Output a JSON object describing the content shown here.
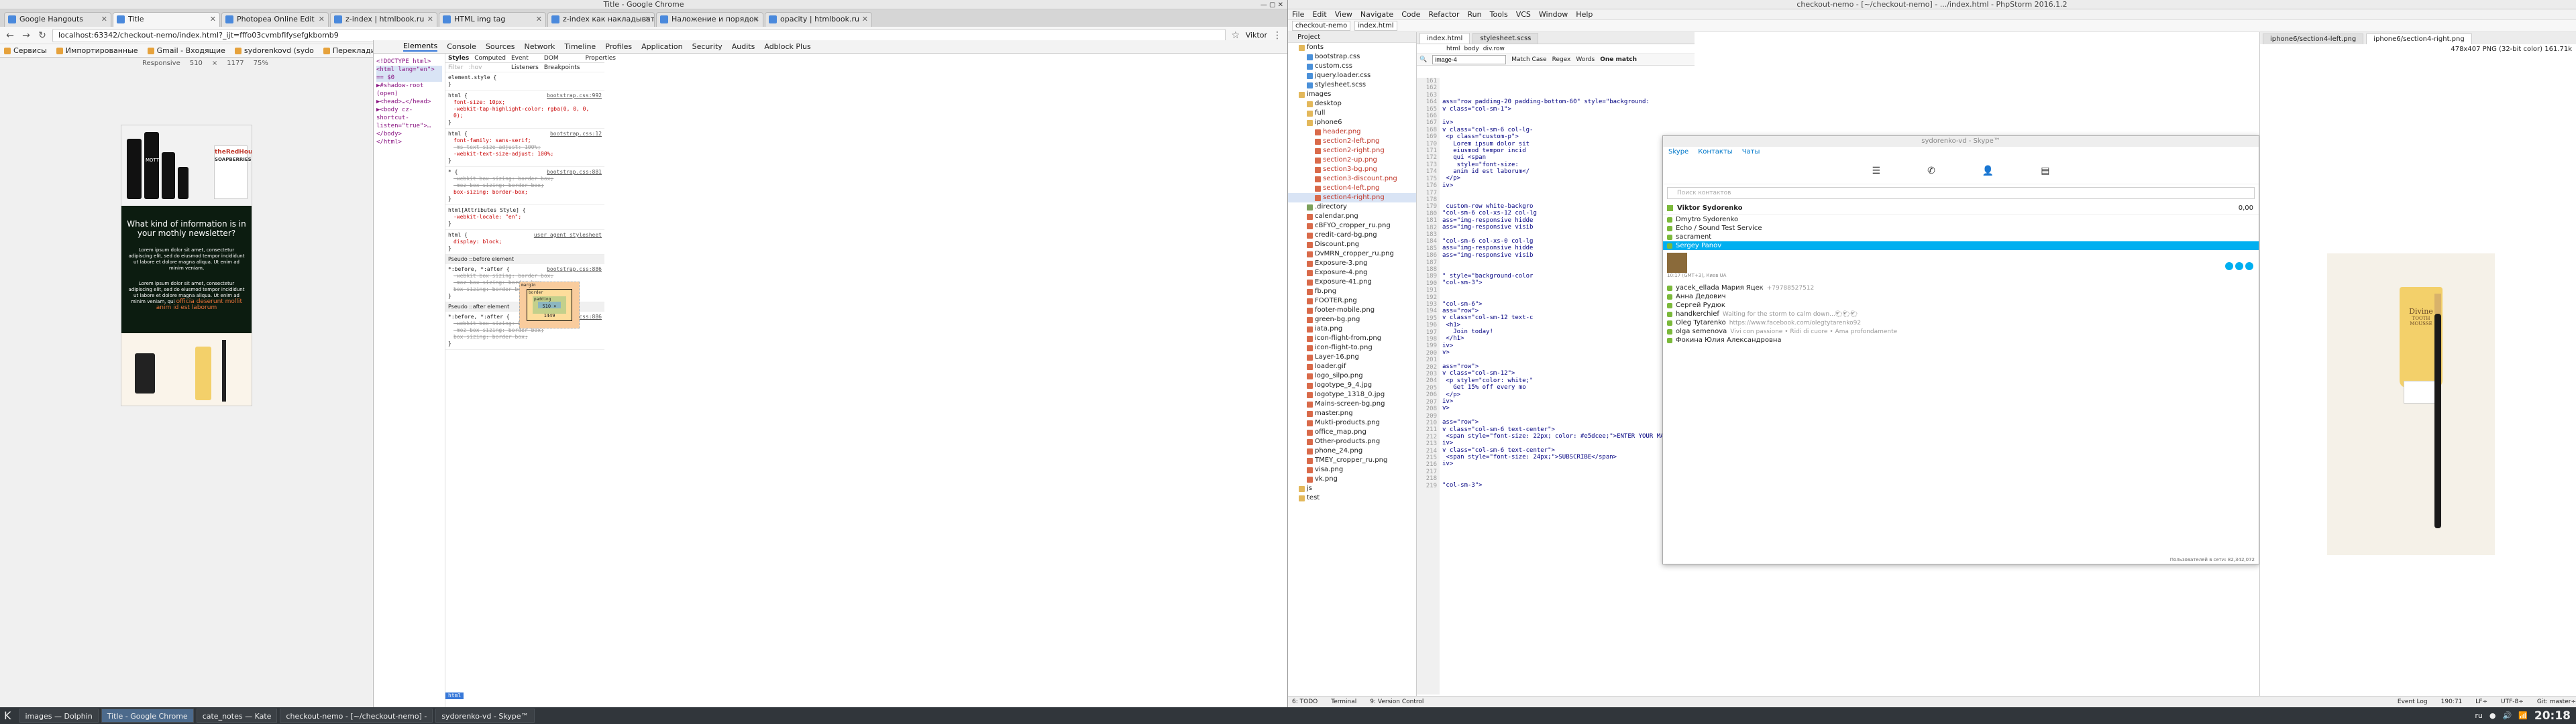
{
  "chrome": {
    "window_title": "Title - Google Chrome",
    "tabs": [
      "Google Hangouts",
      "Title",
      "Photopea Online Edit",
      "z-index | htmlbook.ru",
      "HTML img tag",
      "z-index как накладывать сло",
      "Наложение и порядок",
      "opacity | htmlbook.ru"
    ],
    "active_tab": 1,
    "user": "Viktor",
    "url": "localhost:63342/checkout-nemo/index.html?_ijt=fffo03cvmbfifysefgkbomb9",
    "bookmarks": [
      "Сервисы",
      "Импортированные",
      "Gmail - Входящие",
      "sydorenkovd (sydo",
      "Переклади Goo",
      "W3Schools Online",
      "AngularJS: Develo",
      "delete"
    ],
    "device": {
      "name": "Responsive",
      "width": "510",
      "x": "×",
      "height": "1177",
      "zoom": "75%"
    }
  },
  "page": {
    "newsletter_title": "What kind of information is in your mothly newsletter?",
    "para1": "Lorem ipsum dolor sit amet, consectetur adipiscing elit, sed do eiusmod tempor incididunt ut labore et dolore magna aliqua. Ut enim ad minim veniam,",
    "para2": "Lorem ipsum dolor sit amet, consectetur adipiscing elit, sed do eiusmod tempor incididunt ut labore et dolore magna aliqua. Ut enim ad minim veniam, qui",
    "para2_accent": "officia deserunt mollit anim id est laborum",
    "brand1": "MOTTI",
    "brand2": "theRedHour",
    "brand2_sub": "SOAPBERRIES"
  },
  "devtools": {
    "tabs": [
      "Elements",
      "Console",
      "Sources",
      "Network",
      "Timeline",
      "Profiles",
      "Application",
      "Security",
      "Audits",
      "Adblock Plus"
    ],
    "dom": [
      "<!DOCTYPE html>",
      "<html lang=\"en\"> == $0",
      "▶#shadow-root (open)",
      "▶<head>…</head>",
      "▶<body cz-shortcut-listen=\"true\">…</body>",
      "</html>"
    ],
    "styles_tabs": [
      "Styles",
      "Computed",
      "Event Listeners",
      "DOM Breakpoints",
      "Properties"
    ],
    "filter": "Filter",
    "filter_opts": ":hov",
    "rules": [
      {
        "sel": "element.style {",
        "src": "",
        "props": []
      },
      {
        "sel": "html {",
        "src": "bootstrap.css:992",
        "props": [
          "font-size: 10px;",
          "-webkit-tap-highlight-color: rgba(0, 0, 0, 0);"
        ]
      },
      {
        "sel": "html {",
        "src": "bootstrap.css:12",
        "props": [
          "font-family: sans-serif;",
          "-ms-text-size-adjust: 100%;",
          "-webkit-text-size-adjust: 100%;"
        ]
      },
      {
        "sel": "* {",
        "src": "bootstrap.css:881",
        "props": [
          "-webkit-box-sizing: border-box;",
          "-moz-box-sizing: border-box;",
          "box-sizing: border-box;"
        ]
      },
      {
        "sel": "html[Attributes Style] {",
        "src": "",
        "props": [
          "-webkit-locale: \"en\";"
        ]
      },
      {
        "sel": "html {",
        "src": "user agent stylesheet",
        "props": [
          "display: block;"
        ]
      }
    ],
    "pseudo_before": "Pseudo ::before element",
    "before_rule": {
      "sel": "*:before, *:after {",
      "src": "bootstrap.css:886",
      "props": [
        "-webkit-box-sizing: border-box;",
        "-moz-box-sizing: border-box;",
        "box-sizing: border-box;"
      ]
    },
    "pseudo_after": "Pseudo ::after element",
    "after_rule": {
      "sel": "*:before, *:after {",
      "src": "bootstrap.css:886",
      "props": [
        "-webkit-box-sizing: border-box;",
        "-moz-box-sizing: border-box;",
        "box-sizing: border-box;"
      ]
    },
    "boxmodel": {
      "margin": "margin",
      "border": "border",
      "padding": "padding",
      "content": "510 × 1449"
    },
    "html_tag": "html"
  },
  "ide": {
    "title": "checkout-nemo - [~/checkout-nemo] - .../index.html - PhpStorm 2016.1.2",
    "menu": [
      "File",
      "Edit",
      "View",
      "Navigate",
      "Code",
      "Refactor",
      "Run",
      "Tools",
      "VCS",
      "Window",
      "Help"
    ],
    "breadcrumb": [
      "checkout-nemo",
      "index.html"
    ],
    "project_label": "Project",
    "tree": [
      {
        "name": "fonts",
        "type": "folder"
      },
      {
        "name": "bootstrap.css",
        "type": "css"
      },
      {
        "name": "custom.css",
        "type": "css"
      },
      {
        "name": "jquery.loader.css",
        "type": "css"
      },
      {
        "name": "stylesheet.scss",
        "type": "css"
      },
      {
        "name": "images",
        "type": "folder"
      },
      {
        "name": "desktop",
        "type": "folder"
      },
      {
        "name": "full",
        "type": "folder"
      },
      {
        "name": "iphone6",
        "type": "folder"
      },
      {
        "name": "header.png",
        "type": "img"
      },
      {
        "name": "section2-left.png",
        "type": "img"
      },
      {
        "name": "section2-right.png",
        "type": "img"
      },
      {
        "name": "section2-up.png",
        "type": "img"
      },
      {
        "name": "section3-bg.png",
        "type": "img"
      },
      {
        "name": "section3-discount.png",
        "type": "img"
      },
      {
        "name": "section4-left.png",
        "type": "img"
      },
      {
        "name": "section4-right.png",
        "type": "img"
      },
      {
        "name": ".directory",
        "type": "file"
      },
      {
        "name": "calendar.png",
        "type": "img"
      },
      {
        "name": "cBFYO_cropper_ru.png",
        "type": "img"
      },
      {
        "name": "credit-card-bg.png",
        "type": "img"
      },
      {
        "name": "Discount.png",
        "type": "img"
      },
      {
        "name": "DvMRN_cropper_ru.png",
        "type": "img"
      },
      {
        "name": "Exposure-3.png",
        "type": "img"
      },
      {
        "name": "Exposure-4.png",
        "type": "img"
      },
      {
        "name": "Exposure-41.png",
        "type": "img"
      },
      {
        "name": "fb.png",
        "type": "img"
      },
      {
        "name": "FOOTER.png",
        "type": "img"
      },
      {
        "name": "footer-mobile.png",
        "type": "img"
      },
      {
        "name": "green-bg.png",
        "type": "img"
      },
      {
        "name": "iata.png",
        "type": "img"
      },
      {
        "name": "icon-flight-from.png",
        "type": "img"
      },
      {
        "name": "icon-flight-to.png",
        "type": "img"
      },
      {
        "name": "Layer-16.png",
        "type": "img"
      },
      {
        "name": "loader.gif",
        "type": "img"
      },
      {
        "name": "logo_silpo.png",
        "type": "img"
      },
      {
        "name": "logotype_9_4.jpg",
        "type": "img"
      },
      {
        "name": "logotype_1318_0.jpg",
        "type": "img"
      },
      {
        "name": "Mains-screen-bg.png",
        "type": "img"
      },
      {
        "name": "master.png",
        "type": "img"
      },
      {
        "name": "Mukti-products.png",
        "type": "img"
      },
      {
        "name": "office_map.png",
        "type": "img"
      },
      {
        "name": "Other-products.png",
        "type": "img"
      },
      {
        "name": "phone_24.png",
        "type": "img"
      },
      {
        "name": "TMEY_cropper_ru.png",
        "type": "img"
      },
      {
        "name": "visa.png",
        "type": "img"
      },
      {
        "name": "vk.png",
        "type": "img"
      },
      {
        "name": "js",
        "type": "folder"
      },
      {
        "name": "test",
        "type": "folder"
      }
    ],
    "editor_tabs": [
      "index.html",
      "stylesheet.scss"
    ],
    "code_crumbs": [
      "html",
      "body",
      "div.row"
    ],
    "search_value": "image-4",
    "search_opts": [
      "Match Case",
      "Regex",
      "Words"
    ],
    "search_result": "One match",
    "line_start": 161,
    "code": [
      "",
      "",
      "",
      "ass=\"row padding-20 padding-bottom-60\" style=\"background:",
      "v class=\"col-sm-1\">",
      "",
      "iv>",
      "v class=\"col-sm-6 col-lg-",
      " <p class=\"custom-p\">",
      "   Lorem ipsum dolor sit",
      "   eiusmod tempor incid",
      "   qui <span",
      "    style=\"font-size:",
      "   anim id est laborum</",
      " </p>",
      "iv>",
      "",
      "",
      " custom-row white-backgro",
      "\"col-sm-6 col-xs-12 col-lg",
      "ass=\"img-responsive hidde",
      "ass=\"img-responsive visib",
      "",
      "\"col-sm-6 col-xs-0 col-lg",
      "ass=\"img-responsive hidde",
      "ass=\"img-responsive visib",
      "",
      "",
      "\" style=\"background-color",
      "\"col-sm-3\">",
      "",
      "",
      "\"col-sm-6\">",
      "ass=\"row\">",
      "v class=\"col-sm-12 text-c",
      " <h1>",
      "   Join today!",
      " </h1>",
      "iv>",
      "v>",
      "",
      "ass=\"row\">",
      "v class=\"col-sm-12\">",
      " <p style=\"color: white;\"",
      "   Get 15% off every mo",
      " </p>",
      "iv>",
      "v>",
      "",
      "ass=\"row\">",
      "v class=\"col-sm-6 text-center\">",
      " <span style=\"font-size: 22px; color: #e5dcee;\">ENTER YOUR MAIL</span>",
      "iv>",
      "v class=\"col-sm-6 text-center\">",
      " <span style=\"font-size: 24px;\">SUBSCRIBE</span>",
      "iv>",
      "",
      "",
      "\"col-sm-3\">"
    ]
  },
  "skype": {
    "title": "sydorenko-vd - Skype™",
    "menu": [
      "Skype",
      "Контакты",
      "Чаты"
    ],
    "search_placeholder": "Поиск контактов",
    "user": "Viktor Sydorenko",
    "balance": "0,00",
    "contacts": [
      {
        "name": "Dmytro Sydorenko",
        "mood": ""
      },
      {
        "name": "Echo / Sound Test Service",
        "mood": ""
      },
      {
        "name": "sacrament",
        "mood": ""
      },
      {
        "name": "Sergey Panov",
        "mood": ""
      },
      {
        "name": "yacek_ellada Мария Яцек",
        "mood": "+79788527512"
      },
      {
        "name": "Анна Дедович",
        "mood": ""
      },
      {
        "name": "Сергей Рудюк",
        "mood": ""
      },
      {
        "name": "handkerchief",
        "mood": "Waiting for the storm to calm down...🐑🐑🐑"
      },
      {
        "name": "Oleg Tytarenko",
        "mood": "https://www.facebook.com/olegtytarenko92"
      },
      {
        "name": "olga semenova",
        "mood": "Vivi con passione • Ridi di cuore • Ama profondamente"
      },
      {
        "name": "Фокина Юлия Александровна",
        "mood": ""
      }
    ],
    "selected": 3,
    "contact_meta": "10:17 (GMT+3), Киев UA",
    "footer": "Пользователей в сети: 82,342,072"
  },
  "imgview": {
    "tabs": [
      "iphone6/section4-left.png",
      "iphone6/section4-right.png"
    ],
    "info": "478x407 PNG (32-bit color) 161.71k",
    "brand": "Divine",
    "product": "TOOTH MOUSSE"
  },
  "taskbar": {
    "tasks": [
      "images — Dolphin",
      "Title - Google Chrome",
      "cate_notes — Kate",
      "checkout-nemo - [~/checkout-nemo] -",
      "sydorenko-vd - Skype™"
    ],
    "active": 1,
    "lang": "ru",
    "clock": "20:18"
  },
  "ide_status": {
    "items": [
      "6: TODO",
      "Terminal",
      "9: Version Control"
    ],
    "right": [
      "190:71",
      "LF÷",
      "UTF-8÷",
      "Git: master÷"
    ],
    "event_log": "Event Log"
  }
}
